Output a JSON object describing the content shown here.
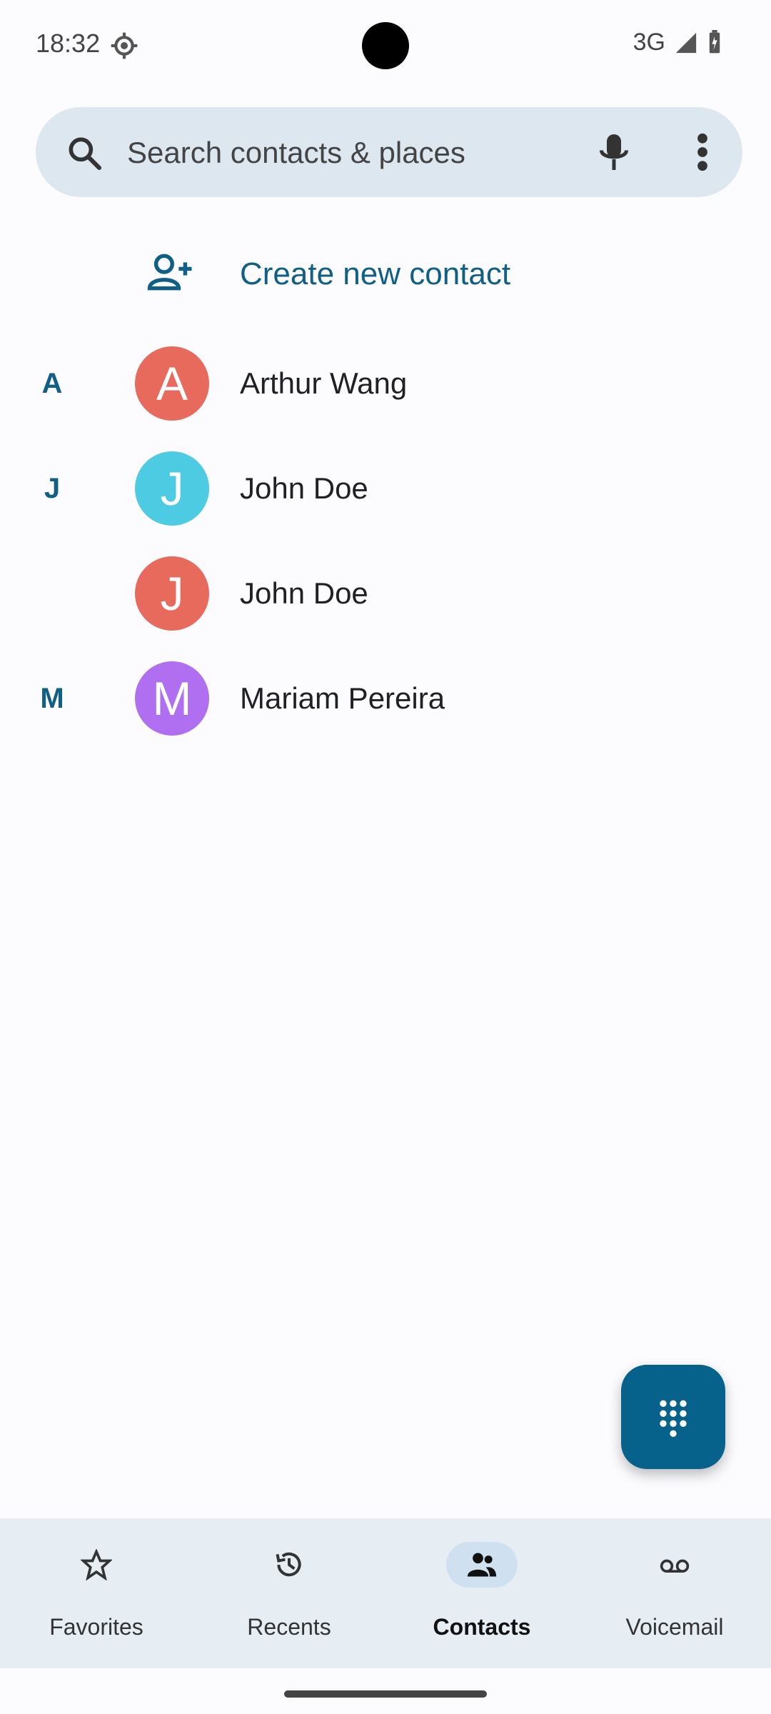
{
  "status_bar": {
    "time": "18:32",
    "network": "3G",
    "icons": [
      "settings-icon",
      "signal-icon",
      "battery-icon"
    ]
  },
  "search": {
    "placeholder": "Search contacts & places",
    "icons": [
      "search-icon",
      "mic-icon",
      "more-vert-icon"
    ]
  },
  "create": {
    "label": "Create new contact",
    "icon": "person-add-icon"
  },
  "contacts": [
    {
      "section": "A",
      "initial": "A",
      "name": "Arthur Wang",
      "color": "#e86a5c"
    },
    {
      "section": "J",
      "initial": "J",
      "name": "John Doe",
      "color": "#4ccbe3"
    },
    {
      "section": "",
      "initial": "J",
      "name": "John Doe",
      "color": "#e86a5c"
    },
    {
      "section": "M",
      "initial": "M",
      "name": "Mariam Pereira",
      "color": "#b06ff0"
    }
  ],
  "fab": {
    "icon": "dialpad-icon"
  },
  "bottom_nav": {
    "items": [
      {
        "label": "Favorites",
        "icon": "star-icon",
        "active": false
      },
      {
        "label": "Recents",
        "icon": "history-icon",
        "active": false
      },
      {
        "label": "Contacts",
        "icon": "people-icon",
        "active": true
      },
      {
        "label": "Voicemail",
        "icon": "voicemail-icon",
        "active": false
      }
    ]
  },
  "colors": {
    "accent": "#0f5f86",
    "fab": "#06628a",
    "search_bg": "#dde7ef",
    "nav_bg": "#e6edf3"
  }
}
